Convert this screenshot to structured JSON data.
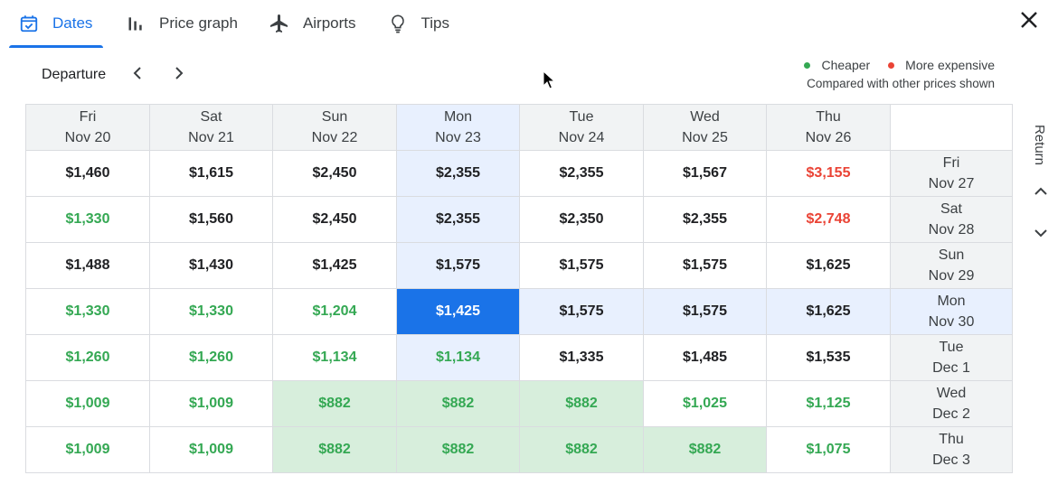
{
  "tabs": [
    {
      "label": "Dates",
      "icon": "calendar-icon",
      "active": true
    },
    {
      "label": "Price graph",
      "icon": "bar-chart-icon",
      "active": false
    },
    {
      "label": "Airports",
      "icon": "airplane-icon",
      "active": false
    },
    {
      "label": "Tips",
      "icon": "lightbulb-icon",
      "active": false
    }
  ],
  "departure_label": "Departure",
  "return_label": "Return",
  "legend": {
    "cheaper": "Cheaper",
    "more_expensive": "More expensive",
    "note": "Compared with other prices shown",
    "cheaper_color": "#34a853",
    "expensive_color": "#ea4335"
  },
  "columns": [
    {
      "day": "Fri",
      "date": "Nov 20"
    },
    {
      "day": "Sat",
      "date": "Nov 21"
    },
    {
      "day": "Sun",
      "date": "Nov 22"
    },
    {
      "day": "Mon",
      "date": "Nov 23"
    },
    {
      "day": "Tue",
      "date": "Nov 24"
    },
    {
      "day": "Wed",
      "date": "Nov 25"
    },
    {
      "day": "Thu",
      "date": "Nov 26"
    }
  ],
  "rows": [
    {
      "day": "Fri",
      "date": "Nov 27",
      "prices": [
        "$1,460",
        "$1,615",
        "$2,450",
        "$2,355",
        "$2,355",
        "$1,567",
        "$3,155"
      ]
    },
    {
      "day": "Sat",
      "date": "Nov 28",
      "prices": [
        "$1,330",
        "$1,560",
        "$2,450",
        "$2,355",
        "$2,350",
        "$2,355",
        "$2,748"
      ]
    },
    {
      "day": "Sun",
      "date": "Nov 29",
      "prices": [
        "$1,488",
        "$1,430",
        "$1,425",
        "$1,575",
        "$1,575",
        "$1,575",
        "$1,625"
      ]
    },
    {
      "day": "Mon",
      "date": "Nov 30",
      "prices": [
        "$1,330",
        "$1,330",
        "$1,204",
        "$1,425",
        "$1,575",
        "$1,575",
        "$1,625"
      ]
    },
    {
      "day": "Tue",
      "date": "Dec 1",
      "prices": [
        "$1,260",
        "$1,260",
        "$1,134",
        "$1,134",
        "$1,335",
        "$1,485",
        "$1,535"
      ]
    },
    {
      "day": "Wed",
      "date": "Dec 2",
      "prices": [
        "$1,009",
        "$1,009",
        "$882",
        "$882",
        "$882",
        "$1,025",
        "$1,125"
      ]
    },
    {
      "day": "Thu",
      "date": "Dec 3",
      "prices": [
        "$1,009",
        "$1,009",
        "$882",
        "$882",
        "$882",
        "$882",
        "$1,075"
      ]
    }
  ],
  "selected": {
    "departure": "Mon Nov 23",
    "return": "Mon Nov 30"
  }
}
